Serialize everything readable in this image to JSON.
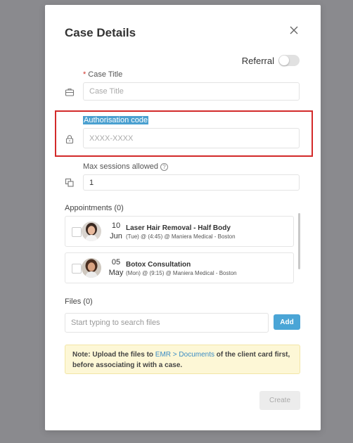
{
  "modal": {
    "title": "Case Details",
    "referral_label": "Referral",
    "referral_enabled": false
  },
  "case_title": {
    "required_mark": "*",
    "label": "Case Title",
    "placeholder": "Case Title",
    "value": ""
  },
  "authorisation": {
    "label": "Authorisation code",
    "placeholder": "XXXX-XXXX",
    "value": ""
  },
  "max_sessions": {
    "label": "Max sessions allowed",
    "info_icon": "?",
    "value": "1"
  },
  "appointments": {
    "label": "Appointments (0)",
    "items": [
      {
        "day": "10",
        "month": "Jun",
        "name": "Laser Hair Removal - Half Body",
        "detail": "(Tue) @ (4:45) @ Maniera Medical - Boston",
        "checked": false
      },
      {
        "day": "05",
        "month": "May",
        "name": "Botox Consultation",
        "detail": "(Mon) @ (9:15) @ Maniera Medical - Boston",
        "checked": false
      }
    ]
  },
  "files": {
    "label": "Files (0)",
    "search_placeholder": "Start typing to search files",
    "add_label": "Add",
    "add_color": "#4aa5d6"
  },
  "note": {
    "prefix": "Note:",
    "text_1": " Upload the files to ",
    "link": "EMR > Documents",
    "text_2": " of the client card first, before associating it with a case."
  },
  "footer": {
    "create_label": "Create"
  },
  "colors": {
    "highlight_box": "#d32a2a",
    "accent": "#4aa5d6",
    "required": "#d0342c"
  }
}
